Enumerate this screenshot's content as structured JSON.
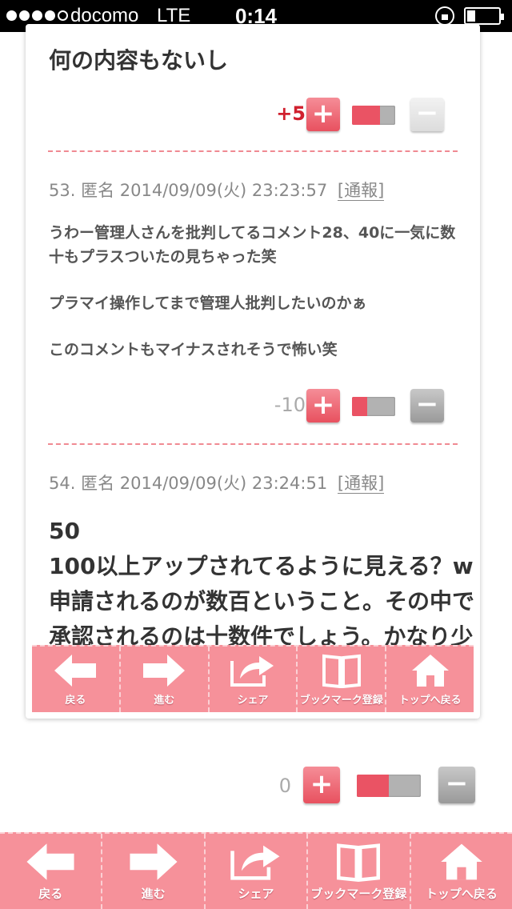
{
  "status_bar": {
    "carrier": "docomo",
    "network": "LTE",
    "time": "0:14"
  },
  "top_comment": {
    "text": "何の内容もないし",
    "score": "+5",
    "positive_ratio": 0.65
  },
  "comments": [
    {
      "number": "53.",
      "author": "匿名",
      "datetime": "2014/09/09(火) 23:23:57",
      "report_label": "[通報]",
      "paragraphs": [
        "うわー管理人さんを批判してるコメント28、40に一気に数",
        "十もプラスついたの見ちゃった笑",
        "プラマイ操作してまで管理人批判したいのかぁ",
        "このコメントもマイナスされそうで怖い笑"
      ],
      "score": "-10",
      "positive_ratio": 0.35
    },
    {
      "number": "54.",
      "author": "匿名",
      "datetime": "2014/09/09(火) 23:24:51",
      "report_label": "[通報]",
      "lines": [
        "50",
        "100以上アップされてるように見える？w",
        "申請されるのが数百ということ。その中で",
        "承認されるのは十数件でしょう。かなり少"
      ]
    }
  ],
  "outer_vote": {
    "score": "0",
    "positive_ratio": 0.5
  },
  "nav": {
    "back": "戻る",
    "forward": "進む",
    "share": "シェア",
    "bookmark": "ブックマーク登録",
    "top": "トップへ戻る"
  },
  "colors": {
    "accent_pink": "#f6919a",
    "plus_red": "#e8515f",
    "score_positive": "#d0202e",
    "score_negative": "#aaaaaa",
    "divider": "#f08a92"
  },
  "icons": [
    "arrow-left-icon",
    "arrow-right-icon",
    "share-icon",
    "book-icon",
    "home-icon",
    "plus-icon",
    "minus-icon"
  ]
}
